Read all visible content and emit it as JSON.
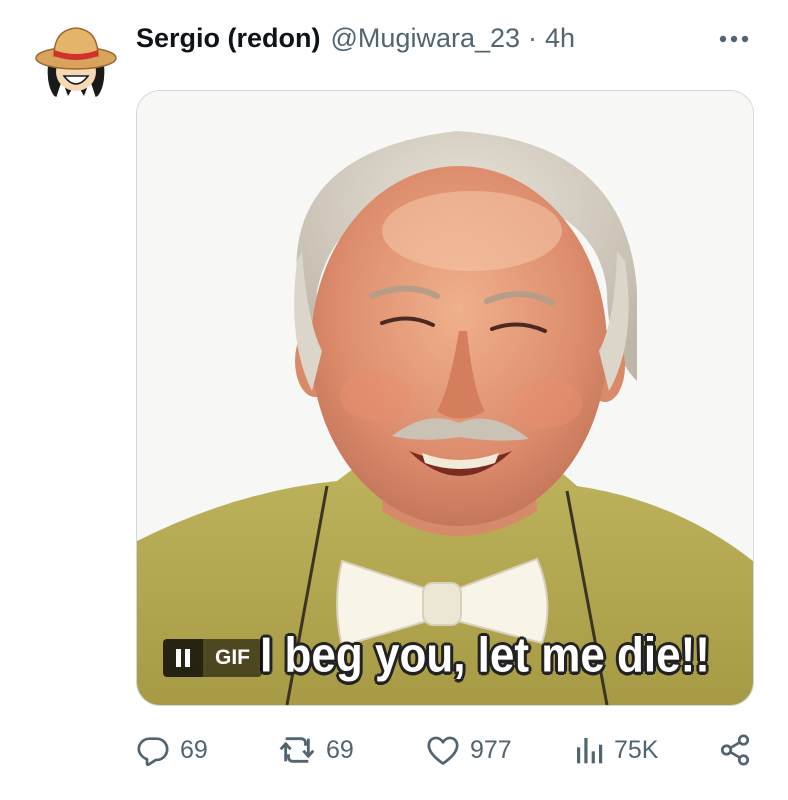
{
  "tweet": {
    "author_name": "Sergio (redon)",
    "handle": "@Mugiwara_23",
    "separator": "·",
    "time": "4h",
    "media": {
      "type_badge": "GIF",
      "caption": "I beg you, let me die!!"
    },
    "stats": {
      "replies": "69",
      "retweets": "69",
      "likes": "977",
      "views": "75K"
    }
  },
  "icons": {
    "more": "more-horizontal-icon",
    "reply": "reply-icon",
    "retweet": "retweet-icon",
    "like": "heart-icon",
    "views": "views-icon",
    "share": "share-icon",
    "pause": "pause-icon"
  },
  "colors": {
    "text_primary": "#0f1419",
    "text_secondary": "#536471",
    "border": "#cfd9de"
  }
}
